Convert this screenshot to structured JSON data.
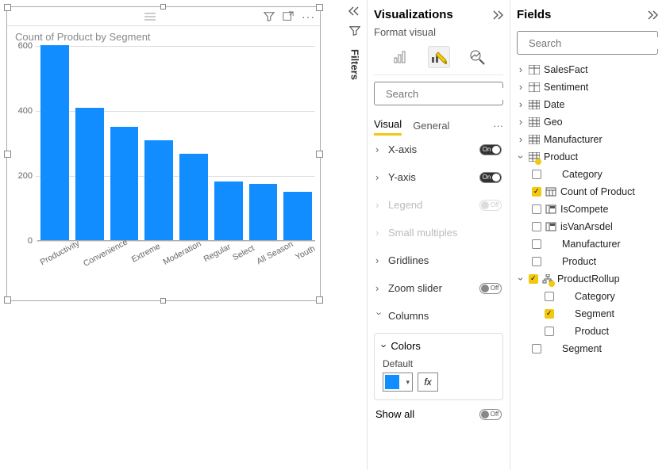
{
  "visual": {
    "title": "Count of Product by Segment"
  },
  "chart_data": {
    "type": "bar",
    "title": "Count of Product by Segment",
    "categories": [
      "Productivity",
      "Convenience",
      "Extreme",
      "Moderation",
      "Regular",
      "Select",
      "All Season",
      "Youth"
    ],
    "values": [
      600,
      408,
      350,
      308,
      265,
      180,
      172,
      148
    ],
    "ylabel": "",
    "xlabel": "",
    "ylim": [
      0,
      600
    ],
    "yticks": [
      0,
      200,
      400,
      600
    ]
  },
  "panels": {
    "filters": "Filters",
    "viz": {
      "title": "Visualizations",
      "subtitle": "Format visual",
      "search_placeholder": "Search",
      "tabs": {
        "visual": "Visual",
        "general": "General"
      },
      "sections": {
        "xaxis": "X-axis",
        "yaxis": "Y-axis",
        "legend": "Legend",
        "small_multiples": "Small multiples",
        "gridlines": "Gridlines",
        "zoom_slider": "Zoom slider",
        "columns": "Columns"
      },
      "toggle_on": "On",
      "toggle_off": "Off",
      "colors": {
        "header": "Colors",
        "default_label": "Default",
        "fx": "fx",
        "show_all": "Show all"
      }
    },
    "fields": {
      "title": "Fields",
      "search_placeholder": "Search",
      "tables": {
        "salesfact": "SalesFact",
        "sentiment": "Sentiment",
        "date": "Date",
        "geo": "Geo",
        "manufacturer": "Manufacturer",
        "product": "Product"
      },
      "product_fields": {
        "category": "Category",
        "count_of_product": "Count of Product",
        "iscompete": "IsCompete",
        "isvanarsdel": "isVanArsdel",
        "manufacturer": "Manufacturer",
        "product": "Product",
        "productrollup": "ProductRollup"
      },
      "rollup_fields": {
        "category": "Category",
        "segment": "Segment",
        "product": "Product"
      },
      "segment_bottom": "Segment"
    }
  }
}
